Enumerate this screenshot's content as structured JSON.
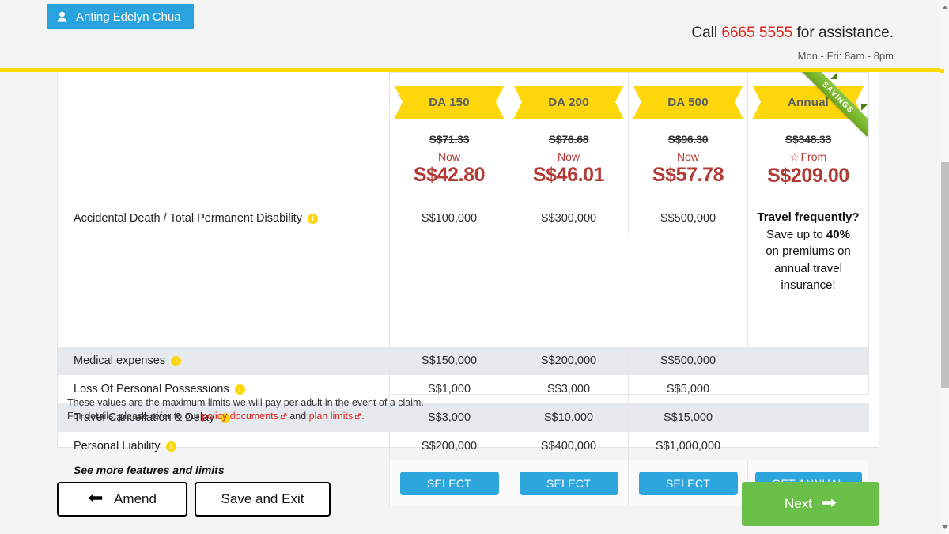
{
  "header": {
    "user_name": "Anting Edelyn Chua",
    "user_icon": "person-icon",
    "call_prefix": "Call ",
    "call_number": "6665 5555",
    "call_suffix": " for assistance.",
    "hours": "Mon - Fri: 8am - 8pm"
  },
  "plans": [
    {
      "name": "DA 150",
      "price_was": "S$71.33",
      "now_label": "Now",
      "price_now": "S$42.80",
      "button": "SELECT",
      "badge": null
    },
    {
      "name": "DA 200",
      "price_was": "S$76.68",
      "now_label": "Now",
      "price_now": "S$46.01",
      "button": "SELECT",
      "badge": null
    },
    {
      "name": "DA 500",
      "price_was": "S$96.30",
      "now_label": "Now",
      "price_now": "S$57.78",
      "button": "SELECT",
      "badge": null
    },
    {
      "name": "Annual",
      "price_was": "S$348.33",
      "now_label": "From",
      "price_now": "S$209.00",
      "button": "GET ANNUAL",
      "badge": "SAVINGS"
    }
  ],
  "features": [
    {
      "label": "Accidental Death / Total Permanent Disability",
      "info": "info-icon",
      "values": [
        "S$100,000",
        "S$300,000",
        "S$500,000"
      ]
    },
    {
      "label": "Medical expenses",
      "info": "info-icon",
      "values": [
        "S$150,000",
        "S$200,000",
        "S$500,000"
      ]
    },
    {
      "label": "Loss Of Personal Possessions",
      "info": "info-icon",
      "values": [
        "S$1,000",
        "S$3,000",
        "S$5,000"
      ]
    },
    {
      "label": "Travel Cancellation & Delay",
      "info": "info-icon",
      "values": [
        "S$3,000",
        "S$10,000",
        "S$15,000"
      ]
    },
    {
      "label": "Personal Liability",
      "info": "info-icon",
      "values": [
        "S$200,000",
        "S$400,000",
        "S$1,000,000"
      ]
    }
  ],
  "annual_promo": {
    "line1": "Travel frequently?",
    "line2_pre": "Save up to ",
    "line2_bold": "40%",
    "line3": "on premiums on",
    "line4": "annual travel",
    "line5": "insurance!"
  },
  "see_more_link": "See more features and limits",
  "footnote": {
    "line1": "These values are the maximum limits we will pay per adult in the event of a claim.",
    "line2_pre": "For details, please refer to our ",
    "link1": "policy documents",
    "line2_mid": " and ",
    "link2": "plan limits",
    "line2_end": "."
  },
  "nav": {
    "amend": "Amend",
    "save_exit": "Save and Exit",
    "next": "Next"
  },
  "colors": {
    "accent_blue": "#2da5dd",
    "brand_yellow": "#ffdd00",
    "price_red": "#b33b36",
    "link_red": "#e2231a",
    "next_green": "#6abf48",
    "savings_green": "#8cc63f"
  }
}
